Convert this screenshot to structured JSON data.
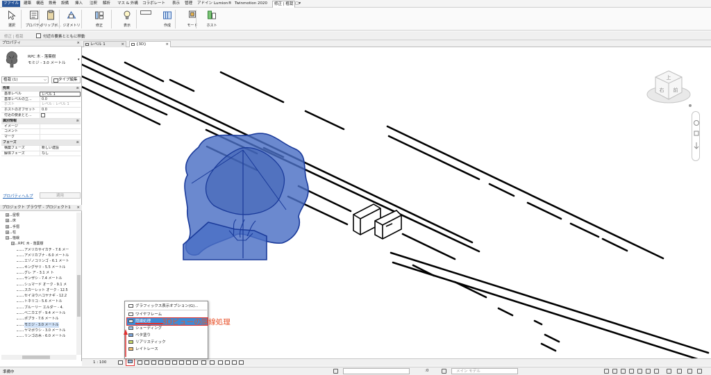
{
  "menu": {
    "tabs": [
      "ファイル",
      "建築",
      "構造",
      "鉄骨",
      "設備",
      "挿入",
      "注釈",
      "解析",
      "マス & 外構",
      "コラボレート",
      "表示",
      "管理",
      "アドイン",
      "Lumion®",
      "Twinmotion 2020",
      "修正 | 植栽",
      "▢▾"
    ],
    "active_tab": "修正 | 植栽"
  },
  "ribbon": {
    "buttons": [
      "選択",
      "プロパティ",
      "クリップボ...",
      "ジオメトリ",
      "修正",
      "表示",
      "作成",
      "モード",
      "ホスト"
    ]
  },
  "options_bar": {
    "context": "修正 | 植栽",
    "checkbox_label": "付近の要素とともに移動"
  },
  "properties": {
    "title": "プロパティ",
    "close": "×",
    "family": "RPC 木 - 落葉樹",
    "type": "モミジ - 3.0 メートル",
    "instance_selector": "植栽 (1)",
    "type_edit": "タイプ編集",
    "rows": [
      {
        "k": "拘束",
        "v": "",
        "group": true,
        "t": "≳"
      },
      {
        "k": "基準レベル",
        "v": "レベル 1",
        "box": true
      },
      {
        "k": "基準レベルの立...",
        "v": "0.0"
      },
      {
        "k": "ホスト",
        "v": "レベル : レベル 1",
        "dim": true
      },
      {
        "k": "ホストのオフセット",
        "v": "0.0"
      },
      {
        "k": "付近の要素とと...",
        "v": "",
        "cb": true
      },
      {
        "k": "識別情報",
        "v": "",
        "group": true,
        "t": "≳"
      },
      {
        "k": "イメージ",
        "v": ""
      },
      {
        "k": "コメント",
        "v": ""
      },
      {
        "k": "マーク",
        "v": ""
      },
      {
        "k": "フェーズ",
        "v": "",
        "group": true,
        "t": "≳"
      },
      {
        "k": "構築フェーズ",
        "v": "新しい建設"
      },
      {
        "k": "解体フェーズ",
        "v": "なし"
      }
    ],
    "help_link": "プロパティヘルプ",
    "apply": "適用"
  },
  "browser": {
    "title": "プロジェクト ブラウザ - プロジェクト1",
    "close": "×",
    "items": [
      {
        "label": "屋根",
        "level": 1,
        "exp": "⊞"
      },
      {
        "label": "床",
        "level": 1,
        "exp": "⊞"
      },
      {
        "label": "手摺",
        "level": 1,
        "exp": "⊞"
      },
      {
        "label": "柱",
        "level": 1,
        "exp": "⊞"
      },
      {
        "label": "植栽",
        "level": 1,
        "exp": "⊟"
      },
      {
        "label": "RPC 木 - 落葉樹",
        "level": 2,
        "exp": "⊟"
      },
      {
        "label": "アメリカサイカチ - 7.6 メー",
        "level": 3
      },
      {
        "label": "アメリカブナ - 6.0 メートル",
        "level": 3
      },
      {
        "label": "エゾノコリンゴ - 6.1 メート",
        "level": 3
      },
      {
        "label": "キングサリ - 5.5 メートル",
        "level": 3
      },
      {
        "label": "グレ  ア - 3.1 メ  ト",
        "level": 3
      },
      {
        "label": "サンザシ - 7.4 メートル",
        "level": 3
      },
      {
        "label": "シュマード オーク - 9.1 メ",
        "level": 3
      },
      {
        "label": "スカーレット オーク - 12.5",
        "level": 3
      },
      {
        "label": "セイヨウハコヤナギ - 12.2",
        "level": 3
      },
      {
        "label": "トネリコ - 5.6 メートル",
        "level": 3
      },
      {
        "label": "ブルーリー エルダー - 4.",
        "level": 3
      },
      {
        "label": "ベニカエデ - 9.4 メートル",
        "level": 3
      },
      {
        "label": "ポプラ - 7.6 メートル",
        "level": 3
      },
      {
        "label": "モミジ - 3.0 メートル",
        "level": 3,
        "sel": true
      },
      {
        "label": "ヤマボウシ - 3.0 メートル",
        "level": 3
      },
      {
        "label": "リンゴの木 - 6.0 メートル",
        "level": 3
      }
    ]
  },
  "view_tabs": [
    {
      "label": "レベル 1",
      "close": "×"
    },
    {
      "label": "{3D}",
      "close": "×",
      "active": true
    }
  ],
  "viewcube": {
    "top": "上",
    "left": "右",
    "front": "前"
  },
  "view_control": {
    "scale": "1 : 100"
  },
  "visual_style_menu": {
    "items": [
      {
        "label": "グラフィックス表示オプション(G)..."
      },
      {
        "label": "ワイヤフレーム"
      },
      {
        "label": "隠線処理",
        "highlighted": true
      },
      {
        "label": "シェーディング"
      },
      {
        "label": "ベタ塗り"
      },
      {
        "label": "リアリスティック"
      },
      {
        "label": "レイトレース"
      }
    ]
  },
  "annotation": "3Dビューの隠線処理",
  "status": {
    "text": "準備中",
    "design_option": "メイン モデル",
    "zero": ":0"
  },
  "colors": {
    "tree_fill": "#4a6fc4",
    "tree_stroke": "#1a3a9a",
    "accent_red": "#e03030",
    "annotation_orange": "#e8532c",
    "highlight_blue": "#3e8bd6",
    "file_tab": "#2b579a"
  }
}
